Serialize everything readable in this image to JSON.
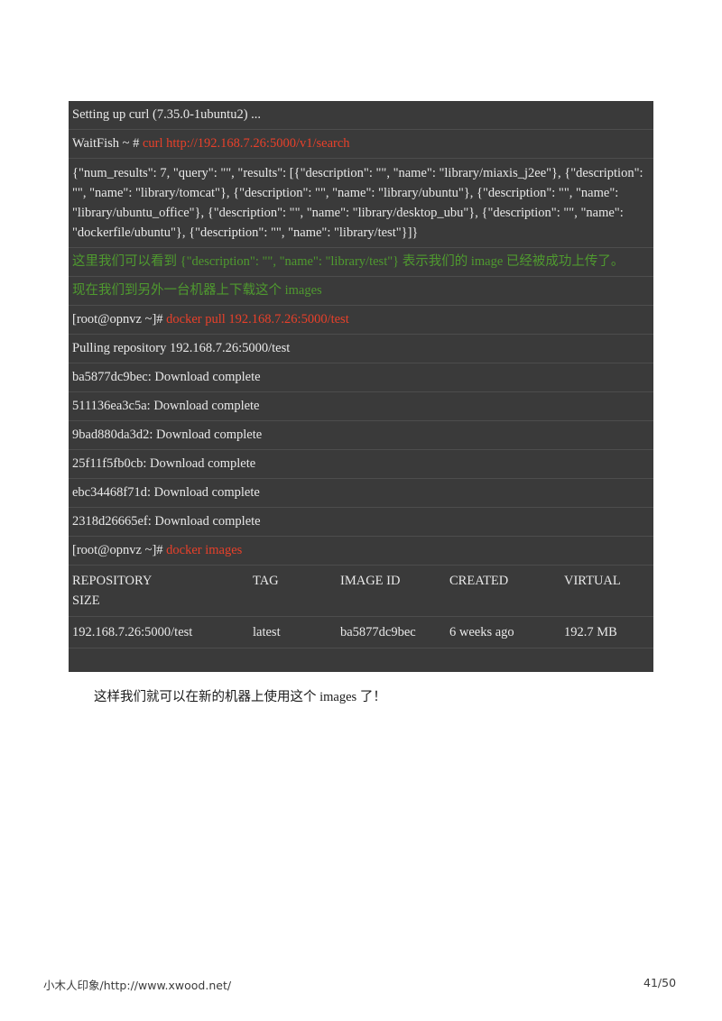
{
  "terminal": {
    "lines": [
      {
        "kind": "plain",
        "text": "Setting up curl (7.35.0-1ubuntu2) ..."
      },
      {
        "kind": "command",
        "prompt": "WaitFish ~ # ",
        "command": "curl http://192.168.7.26:5000/v1/search"
      },
      {
        "kind": "json",
        "text": "{\"num_results\": 7, \"query\": \"\", \"results\": [{\"description\": \"\", \"name\": \"library/miaxis_j2ee\"}, {\"description\": \"\", \"name\": \"library/tomcat\"}, {\"description\": \"\", \"name\": \"library/ubuntu\"}, {\"description\": \"\", \"name\": \"library/ubuntu_office\"}, {\"description\": \"\", \"name\": \"library/desktop_ubu\"}, {\"description\": \"\", \"name\": \"dockerfile/ubuntu\"}, {\"description\": \"\", \"name\": \"library/test\"}]}"
      },
      {
        "kind": "note",
        "text": "这里我们可以看到 {\"description\": \"\", \"name\": \"library/test\"} 表示我们的 image 已经被成功上传了。"
      },
      {
        "kind": "note",
        "text": "现在我们到另外一台机器上下载这个 images"
      },
      {
        "kind": "command",
        "prompt": "[root@opnvz ~]# ",
        "command": "docker pull 192.168.7.26:5000/test"
      },
      {
        "kind": "plain",
        "text": "Pulling repository 192.168.7.26:5000/test"
      },
      {
        "kind": "plain",
        "text": "ba5877dc9bec: Download complete"
      },
      {
        "kind": "plain",
        "text": "511136ea3c5a: Download complete"
      },
      {
        "kind": "plain",
        "text": "9bad880da3d2: Download complete"
      },
      {
        "kind": "plain",
        "text": "25f11f5fb0cb: Download complete"
      },
      {
        "kind": "plain",
        "text": "ebc34468f71d: Download complete"
      },
      {
        "kind": "plain",
        "text": "2318d26665ef: Download complete"
      },
      {
        "kind": "command",
        "prompt": "[root@opnvz ~]# ",
        "command": "docker images"
      }
    ],
    "images_table": {
      "headers": {
        "repository": "REPOSITORY",
        "tag": "TAG",
        "image_id": "IMAGE ID",
        "created": "CREATED",
        "virtual": "VIRTUAL",
        "size": "SIZE"
      },
      "rows": [
        {
          "repository": "192.168.7.26:5000/test",
          "tag": "latest",
          "image_id": "ba5877dc9bec",
          "created": "6 weeks ago",
          "virtual_size": "192.7 MB"
        }
      ]
    }
  },
  "caption": "这样我们就可以在新的机器上使用这个 images 了！",
  "footer": {
    "left": "小木人印象/http://www.xwood.net/",
    "page": "41/50"
  },
  "colors": {
    "terminal_background": "#3a3a3a",
    "terminal_text": "#e9e9e9",
    "command_red": "#e8402a",
    "note_green": "#4f9a2f",
    "separator": "#4d4d4d",
    "page_background": "#ffffff"
  }
}
